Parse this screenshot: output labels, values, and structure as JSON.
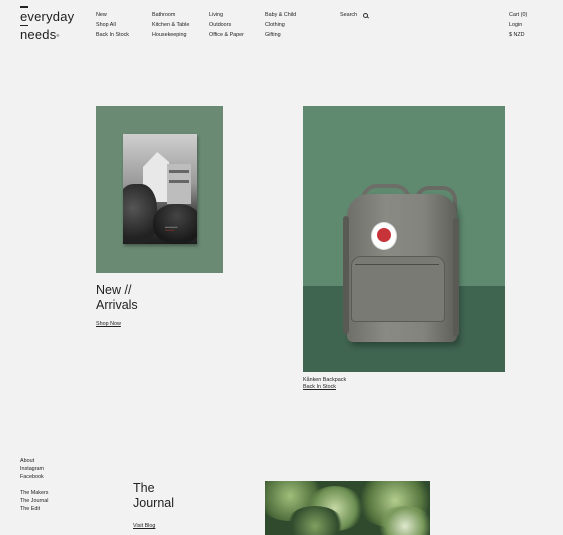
{
  "brand": {
    "line1": "everyday",
    "line2": "needs",
    "mark": "®"
  },
  "nav": {
    "col1": [
      "New",
      "Shop All",
      "Back In Stock"
    ],
    "col2": [
      "Bathroom",
      "Kitchen & Table",
      "Housekeeping"
    ],
    "col3": [
      "Living",
      "Outdoors",
      "Office & Paper"
    ],
    "col4": [
      "Baby & Child",
      "Clothing",
      "Gifting"
    ],
    "search_label": "Search",
    "right": [
      "Cart (0)",
      "Login",
      "$ NZD"
    ]
  },
  "hero": {
    "title_line1": "New //",
    "title_line2": "Arrivals",
    "link": "Shop Now",
    "product_name": "Kånken Backpack",
    "product_link": "Back In Stock"
  },
  "footer": {
    "social": [
      "About",
      "Instagram",
      "Facebook"
    ],
    "more": [
      "The Makers",
      "The Journal",
      "The Edit"
    ],
    "journal_line1": "The",
    "journal_line2": "Journal",
    "journal_link": "Visit Blog"
  },
  "colors": {
    "background": "#f2f2f2",
    "tile_green": "#6b8a74",
    "photo_green": "#5f8a70",
    "text": "#222222"
  }
}
